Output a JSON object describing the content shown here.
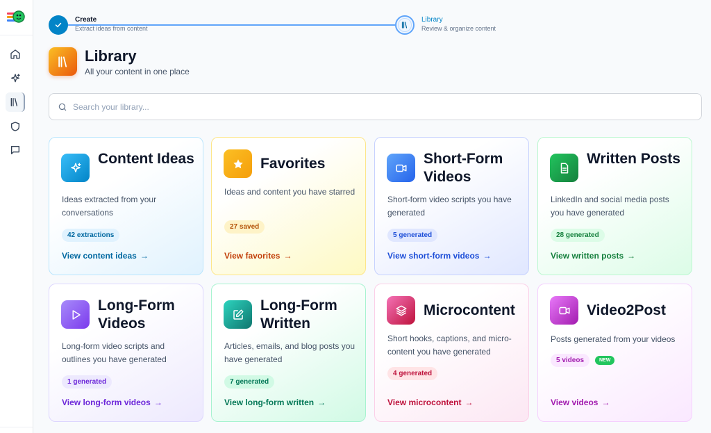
{
  "sidebar": {
    "logo": "app-logo",
    "items": [
      {
        "name": "home",
        "icon": "home-icon"
      },
      {
        "name": "ideas",
        "icon": "sparkle-icon"
      },
      {
        "name": "library",
        "icon": "library-icon",
        "active": true
      },
      {
        "name": "brand",
        "icon": "shield-icon"
      },
      {
        "name": "chat",
        "icon": "chat-icon"
      }
    ]
  },
  "stepper": {
    "steps": [
      {
        "title": "Create",
        "subtitle": "Extract ideas from content",
        "state": "completed"
      },
      {
        "title": "Library",
        "subtitle": "Review & organize content",
        "state": "current"
      }
    ]
  },
  "header": {
    "title": "Library",
    "subtitle": "All your content in one place"
  },
  "search": {
    "placeholder": "Search your library...",
    "value": ""
  },
  "cards": [
    {
      "title": "Content Ideas",
      "description": "Ideas extracted from your conversations",
      "badge": "42 extractions",
      "link": "View content ideas",
      "icon": "sparkle-icon",
      "color": "#0284c7"
    },
    {
      "title": "Favorites",
      "description": "Ideas and content you have starred",
      "badge": "27 saved",
      "link": "View favorites",
      "icon": "star-icon",
      "color": "#f59e0b"
    },
    {
      "title": "Short-Form Videos",
      "description": "Short-form video scripts you have generated",
      "badge": "5 generated",
      "link": "View short-form videos",
      "icon": "video-camera-icon",
      "color": "#2563eb"
    },
    {
      "title": "Written Posts",
      "description": "LinkedIn and social media posts you have generated",
      "badge": "28 generated",
      "link": "View written posts",
      "icon": "document-icon",
      "color": "#15803d"
    },
    {
      "title": "Long-Form Videos",
      "description": "Long-form video scripts and outlines you have generated",
      "badge": "1 generated",
      "link": "View long-form videos",
      "icon": "play-icon",
      "color": "#7c3aed"
    },
    {
      "title": "Long-Form Written",
      "description": "Articles, emails, and blog posts you have generated",
      "badge": "7 generated",
      "link": "View long-form written",
      "icon": "edit-icon",
      "color": "#0f766e"
    },
    {
      "title": "Microcontent",
      "description": "Short hooks, captions, and micro-content you have generated",
      "badge": "4 generated",
      "link": "View microcontent",
      "icon": "layers-icon",
      "color": "#be123c"
    },
    {
      "title": "Video2Post",
      "description": "Posts generated from your videos",
      "badge": "5 videos",
      "new_label": "NEW",
      "link": "View videos",
      "icon": "video-camera-icon",
      "color": "#a21caf"
    }
  ],
  "arrow": "→"
}
